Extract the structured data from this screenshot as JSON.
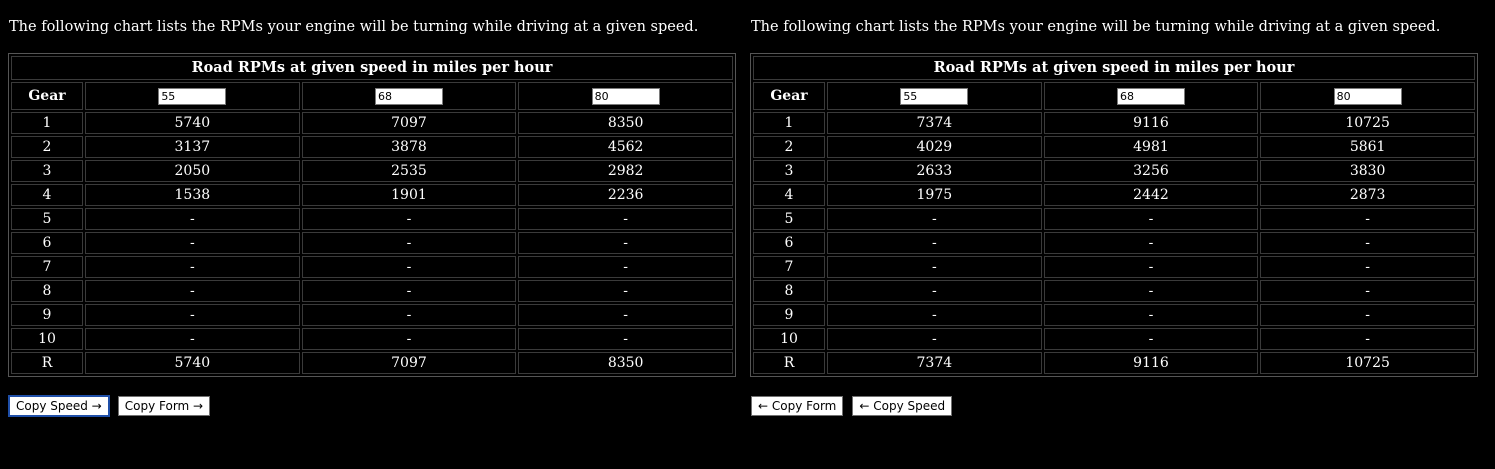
{
  "intro_text": "The following chart lists the RPMs your engine will be turning while driving at a given speed.",
  "table_caption": "Road RPMs at given speed in miles per hour",
  "gear_header": "Gear",
  "left": {
    "speeds": [
      "55",
      "68",
      "80"
    ],
    "rows": [
      {
        "gear": "1",
        "values": [
          "5740",
          "7097",
          "8350"
        ]
      },
      {
        "gear": "2",
        "values": [
          "3137",
          "3878",
          "4562"
        ]
      },
      {
        "gear": "3",
        "values": [
          "2050",
          "2535",
          "2982"
        ]
      },
      {
        "gear": "4",
        "values": [
          "1538",
          "1901",
          "2236"
        ]
      },
      {
        "gear": "5",
        "values": [
          "-",
          "-",
          "-"
        ]
      },
      {
        "gear": "6",
        "values": [
          "-",
          "-",
          "-"
        ]
      },
      {
        "gear": "7",
        "values": [
          "-",
          "-",
          "-"
        ]
      },
      {
        "gear": "8",
        "values": [
          "-",
          "-",
          "-"
        ]
      },
      {
        "gear": "9",
        "values": [
          "-",
          "-",
          "-"
        ]
      },
      {
        "gear": "10",
        "values": [
          "-",
          "-",
          "-"
        ]
      },
      {
        "gear": "R",
        "values": [
          "5740",
          "7097",
          "8350"
        ]
      }
    ],
    "buttons": {
      "copy_speed": "Copy Speed →",
      "copy_form": "Copy Form →"
    }
  },
  "right": {
    "speeds": [
      "55",
      "68",
      "80"
    ],
    "rows": [
      {
        "gear": "1",
        "values": [
          "7374",
          "9116",
          "10725"
        ]
      },
      {
        "gear": "2",
        "values": [
          "4029",
          "4981",
          "5861"
        ]
      },
      {
        "gear": "3",
        "values": [
          "2633",
          "3256",
          "3830"
        ]
      },
      {
        "gear": "4",
        "values": [
          "1975",
          "2442",
          "2873"
        ]
      },
      {
        "gear": "5",
        "values": [
          "-",
          "-",
          "-"
        ]
      },
      {
        "gear": "6",
        "values": [
          "-",
          "-",
          "-"
        ]
      },
      {
        "gear": "7",
        "values": [
          "-",
          "-",
          "-"
        ]
      },
      {
        "gear": "8",
        "values": [
          "-",
          "-",
          "-"
        ]
      },
      {
        "gear": "9",
        "values": [
          "-",
          "-",
          "-"
        ]
      },
      {
        "gear": "10",
        "values": [
          "-",
          "-",
          "-"
        ]
      },
      {
        "gear": "R",
        "values": [
          "7374",
          "9116",
          "10725"
        ]
      }
    ],
    "buttons": {
      "copy_form": "← Copy Form",
      "copy_speed": "← Copy Speed"
    }
  },
  "colors": {
    "background": "#000000",
    "text": "#ffffff",
    "footer_text": "#b22222",
    "focus_outline": "#1f4fa8"
  }
}
